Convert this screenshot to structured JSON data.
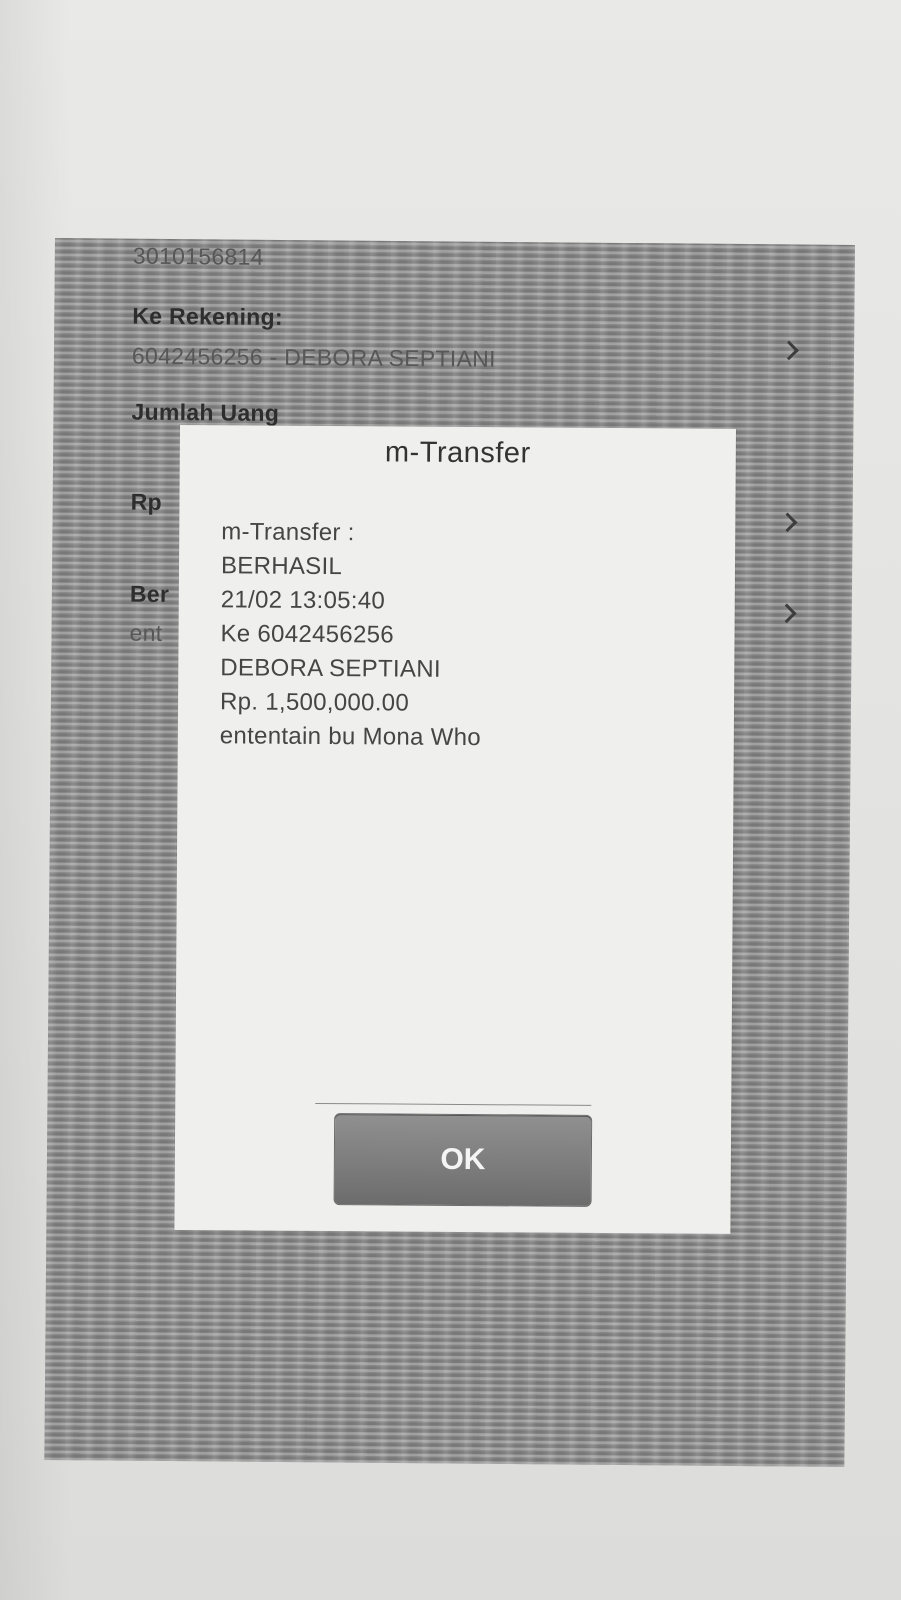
{
  "background_screen": {
    "from_account_number": "3010156814",
    "to_account_label": "Ke Rekening:",
    "to_account_value": "6042456256 - DEBORA SEPTIANI",
    "amount_label": "Jumlah Uang",
    "amount_prefix": "Rp",
    "note_label_partial": "Ber",
    "note_value_partial": "ent"
  },
  "dialog": {
    "title": "m-Transfer",
    "lines": [
      "m-Transfer :",
      "BERHASIL",
      "21/02 13:05:40",
      "Ke 6042456256",
      "DEBORA SEPTIANI",
      "Rp. 1,500,000.00",
      "ententain bu Mona Who"
    ],
    "ok_label": "OK"
  }
}
